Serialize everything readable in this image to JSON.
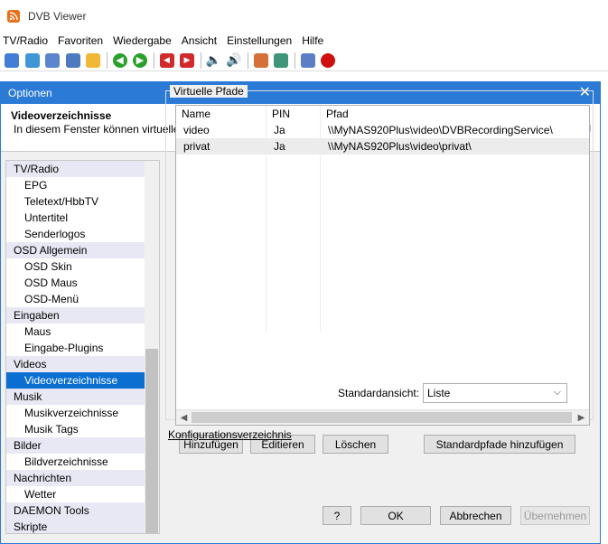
{
  "app": {
    "title": "DVB Viewer"
  },
  "menu": [
    "TV/Radio",
    "Favoriten",
    "Wiedergabe",
    "Ansicht",
    "Einstellungen",
    "Hilfe"
  ],
  "toolbar": {
    "icons": [
      {
        "name": "diamond-icon",
        "color": "#2f6fd0"
      },
      {
        "name": "tv-icon",
        "color": "#2c8bd0"
      },
      {
        "name": "window-icon",
        "color": "#4a78c8"
      },
      {
        "name": "list-icon",
        "color": "#3a6bb8"
      },
      {
        "name": "weather-icon",
        "color": "#f0b020"
      },
      {
        "name": "sep"
      },
      {
        "name": "back-arrow-icon",
        "color": "#2aa02a"
      },
      {
        "name": "forward-arrow-icon",
        "color": "#2aa02a"
      },
      {
        "name": "sep"
      },
      {
        "name": "prev-icon",
        "color": "#d02a2a"
      },
      {
        "name": "next-icon",
        "color": "#d02a2a"
      },
      {
        "name": "sep"
      },
      {
        "name": "volume-down-icon",
        "color": "#e8b020"
      },
      {
        "name": "volume-up-icon",
        "color": "#e8b020"
      },
      {
        "name": "sep"
      },
      {
        "name": "timeshift-icon",
        "color": "#d06020"
      },
      {
        "name": "picture-icon",
        "color": "#2a8a6a"
      },
      {
        "name": "sep"
      },
      {
        "name": "scheduler-icon",
        "color": "#4a70c0"
      },
      {
        "name": "record-icon",
        "color": "#d01010"
      }
    ]
  },
  "dialog": {
    "title": "Optionen",
    "header_title": "Videoverzeichnisse",
    "header_desc": "In diesem Fenster können virtuelle Verzeichnisse für Videodateien festgelegt werden.",
    "tree": [
      {
        "label": "TV/Radio",
        "kind": "cat"
      },
      {
        "label": "EPG",
        "kind": "sub"
      },
      {
        "label": "Teletext/HbbTV",
        "kind": "sub"
      },
      {
        "label": "Untertitel",
        "kind": "sub"
      },
      {
        "label": "Senderlogos",
        "kind": "sub"
      },
      {
        "label": "OSD Allgemein",
        "kind": "cat"
      },
      {
        "label": "OSD Skin",
        "kind": "sub"
      },
      {
        "label": "OSD Maus",
        "kind": "sub"
      },
      {
        "label": "OSD-Menü",
        "kind": "sub"
      },
      {
        "label": "Eingaben",
        "kind": "cat"
      },
      {
        "label": "Maus",
        "kind": "sub"
      },
      {
        "label": "Eingabe-Plugins",
        "kind": "sub"
      },
      {
        "label": "Videos",
        "kind": "cat"
      },
      {
        "label": "Videoverzeichnisse",
        "kind": "sub",
        "selected": true
      },
      {
        "label": "Musik",
        "kind": "cat"
      },
      {
        "label": "Musikverzeichnisse",
        "kind": "sub"
      },
      {
        "label": "Musik Tags",
        "kind": "sub"
      },
      {
        "label": "Bilder",
        "kind": "cat"
      },
      {
        "label": "Bildverzeichnisse",
        "kind": "sub"
      },
      {
        "label": "Nachrichten",
        "kind": "cat"
      },
      {
        "label": "Wetter",
        "kind": "sub"
      },
      {
        "label": "DAEMON Tools",
        "kind": "cat"
      },
      {
        "label": "Skripte",
        "kind": "cat"
      }
    ],
    "group_title": "Virtuelle Pfade",
    "columns": [
      "Name",
      "PIN",
      "Pfad"
    ],
    "rows": [
      {
        "name": "video",
        "pin": "Ja",
        "path": "\\\\MyNAS920Plus\\video\\DVBRecordingService\\"
      },
      {
        "name": "privat",
        "pin": "Ja",
        "path": "\\\\MyNAS920Plus\\video\\privat\\"
      }
    ],
    "buttons": {
      "add": "Hinzufügen",
      "edit": "Editieren",
      "delete": "Löschen",
      "add_defaults": "Standardpfade hinzufügen",
      "help": "?",
      "ok": "OK",
      "cancel": "Abbrechen",
      "apply": "Übernehmen"
    },
    "default_view_label": "Standardansicht:",
    "default_view_value": "Liste",
    "config_link": "Konfigurationsverzeichnis"
  }
}
